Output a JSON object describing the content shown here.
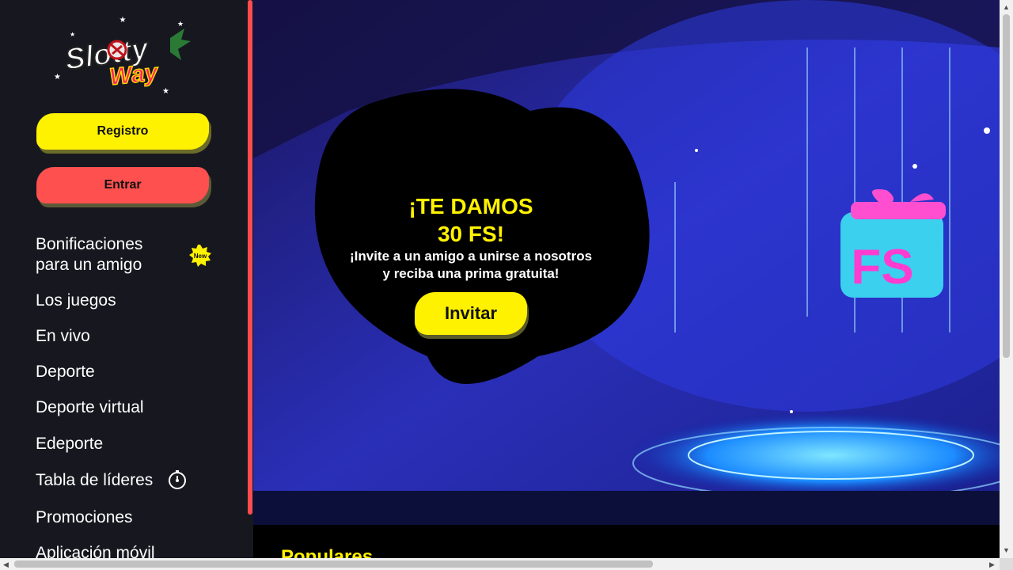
{
  "brand": {
    "logo_line1": "Slotty",
    "logo_line2": "Way"
  },
  "auth": {
    "register_label": "Registro",
    "login_label": "Entrar"
  },
  "menu": {
    "items": [
      {
        "label": "Bonificaciones para un amigo",
        "line1": "Bonificaciones",
        "line2": "para un amigo",
        "badge": "New"
      },
      {
        "label": "Los juegos"
      },
      {
        "label": "En vivo"
      },
      {
        "label": "Deporte"
      },
      {
        "label": "Deporte virtual"
      },
      {
        "label": "Edeporte"
      },
      {
        "label": "Tabla de líderes",
        "icon": "trophy-icon"
      },
      {
        "label": "Promociones"
      },
      {
        "label": "Aplicación móvil"
      }
    ]
  },
  "banner": {
    "title_line1": "¡TE DAMOS",
    "title_line2": "30 FS!",
    "subtitle_line1": "¡Invite a un amigo a unirse a nosotros",
    "subtitle_line2": "y reciba una prima gratuita!",
    "button_label": "Invitar",
    "gift_text": "FS"
  },
  "sections": {
    "popular_title": "Populares"
  },
  "colors": {
    "accent_yellow": "#fff200",
    "accent_red": "#ff4d4f",
    "sidebar_bg": "#17181f"
  }
}
